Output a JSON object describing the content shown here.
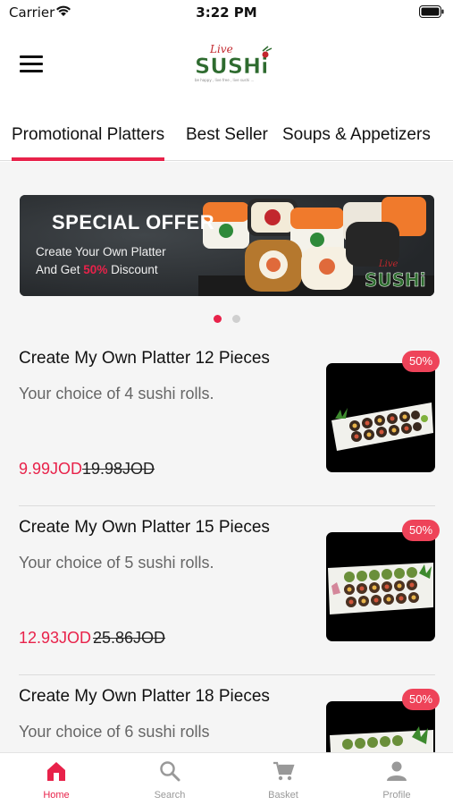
{
  "status_bar": {
    "carrier": "Carrier",
    "time": "3:22 PM"
  },
  "header": {
    "logo_top": "Live",
    "logo_main": "SUSHi",
    "logo_tagline": "be happy , live free , live sushi ..."
  },
  "tabs": [
    {
      "label": "Promotional Platters",
      "active": true
    },
    {
      "label": "Best Seller",
      "active": false
    },
    {
      "label": "Soups & Appetizers",
      "active": false
    }
  ],
  "banner": {
    "title": "SPECIAL OFFER",
    "line1": "Create Your Own Platter",
    "line2_prefix": "And Get ",
    "line2_highlight": "50%",
    "line2_suffix": " Discount",
    "logo_top": "Live",
    "logo_main": "SUSHi"
  },
  "pager": {
    "count": 2,
    "active_index": 0
  },
  "items": [
    {
      "name": "Create My Own Platter 12 Pieces",
      "description": "Your choice of 4 sushi rolls.",
      "price": "9.99JOD",
      "old_price": "19.98JOD",
      "badge": "50%"
    },
    {
      "name": "Create My Own Platter 15 Pieces",
      "description": "Your choice of 5 sushi rolls.",
      "price": "12.93JOD",
      "old_price": "25.86JOD",
      "badge": "50%"
    },
    {
      "name": "Create My Own Platter 18 Pieces",
      "description": "Your choice of 6 sushi rolls",
      "price": "",
      "old_price": "",
      "badge": "50%"
    }
  ],
  "bottom_nav": [
    {
      "label": "Home",
      "icon": "home-icon",
      "active": true
    },
    {
      "label": "Search",
      "icon": "search-icon",
      "active": false
    },
    {
      "label": "Basket",
      "icon": "cart-icon",
      "active": false
    },
    {
      "label": "Profile",
      "icon": "profile-icon",
      "active": false
    }
  ],
  "colors": {
    "accent": "#e8224a",
    "badge": "#ee4359",
    "logo_green": "#2e6b2f",
    "inactive": "#999999"
  }
}
